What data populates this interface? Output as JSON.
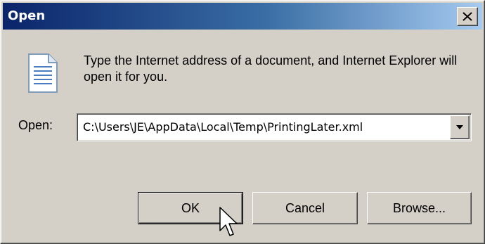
{
  "window": {
    "title": "Open"
  },
  "dialog": {
    "message": "Type the Internet address of a document, and Internet Explorer will open it for you.",
    "open_label": "Open:",
    "open_value": "C:\\Users\\JE\\AppData\\Local\\Temp\\PrintingLater.xml"
  },
  "buttons": {
    "ok": "OK",
    "cancel": "Cancel",
    "browse": "Browse..."
  },
  "icons": {
    "document": "document-icon",
    "close": "close-icon",
    "dropdown": "chevron-down-icon",
    "cursor": "mouse-pointer-icon"
  },
  "colors": {
    "title_gradient_start": "#0a246a",
    "title_gradient_end": "#a6caf0",
    "face": "#d4d0c8"
  }
}
